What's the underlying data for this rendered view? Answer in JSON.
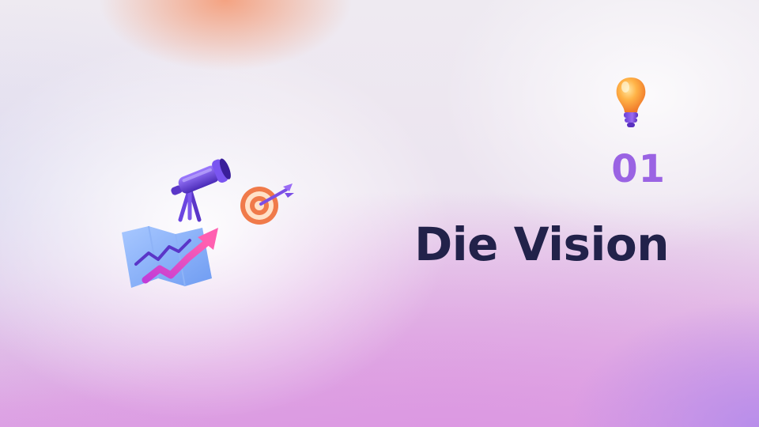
{
  "section": {
    "number": "01",
    "title": "Die Vision"
  },
  "icons": {
    "top_right": "lightbulb-icon",
    "left_group": [
      "telescope-icon",
      "target-dart-icon",
      "map-growth-chart-icon"
    ]
  },
  "colors": {
    "number": "#9a63e3",
    "title": "#22224a",
    "accent_purple": "#7b4fe6",
    "accent_pink": "#e64fc8",
    "accent_orange": "#f59a4f"
  }
}
